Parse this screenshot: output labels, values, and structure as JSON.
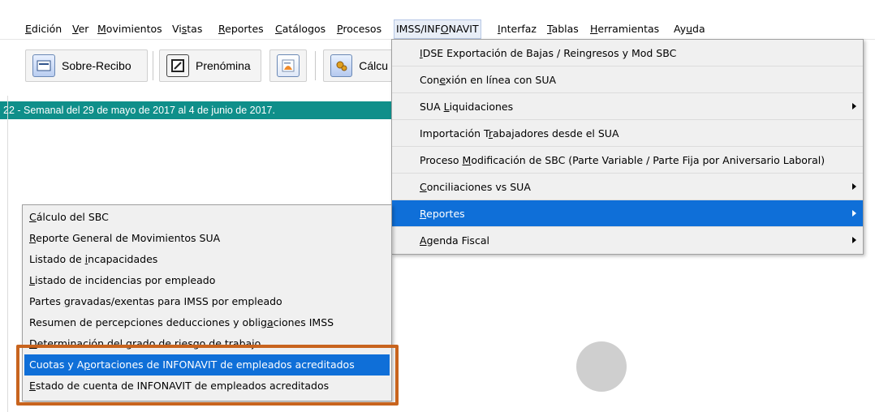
{
  "menubar": [
    {
      "label": "Edición",
      "u": 0
    },
    {
      "label": "Ver",
      "u": 0
    },
    {
      "label": "Movimientos",
      "u": 0
    },
    {
      "label": "Vistas",
      "u": 2
    },
    {
      "label": "Reportes",
      "u": 0
    },
    {
      "label": "Catálogos",
      "u": 0
    },
    {
      "label": "Procesos",
      "u": 0
    },
    {
      "label": "IMSS/INFONAVIT",
      "u": 8
    },
    {
      "label": "Interfaz",
      "u": 0
    },
    {
      "label": "Tablas",
      "u": 0
    },
    {
      "label": "Herramientas",
      "u": 0
    },
    {
      "label": "Ayuda",
      "u": 2
    }
  ],
  "toolbar": {
    "sobre_recibo": "Sobre-Recibo",
    "prenomina": "Prenómina",
    "calculo": "Cálcu"
  },
  "period": "22 - Semanal del 29 de mayo de 2017 al 4 de junio de 2017.",
  "imss_menu": [
    {
      "label": "IDSE Exportación de Bajas / Reingresos y Mod SBC",
      "u": 0,
      "arrow": false
    },
    {
      "label": "Conexión en línea con SUA",
      "u": 3,
      "arrow": false
    },
    {
      "label": "SUA Liquidaciones",
      "u": 4,
      "arrow": true
    },
    {
      "label": "Importación Trabajadores desde el SUA",
      "u": 13,
      "arrow": false
    },
    {
      "label": "Proceso Modificación de SBC (Parte Variable / Parte Fija por Aniversario Laboral)",
      "u": 8,
      "arrow": false
    },
    {
      "label": "Conciliaciones vs SUA",
      "u": 0,
      "arrow": true
    },
    {
      "label": "Reportes",
      "u": 0,
      "arrow": true,
      "selected": true
    },
    {
      "label": "Agenda Fiscal",
      "u": 0,
      "arrow": true
    }
  ],
  "reports_menu": [
    {
      "label": "Cálculo del SBC",
      "u": 0
    },
    {
      "label": "Reporte General de Movimientos SUA",
      "u": 0
    },
    {
      "label": "Listado de incapacidades",
      "u": 11
    },
    {
      "label": "Listado de incidencias por empleado",
      "u": 0
    },
    {
      "label": "Partes gravadas/exentas para IMSS por empleado",
      "u": 7
    },
    {
      "label": "Resumen de percepciones deducciones y obligaciones IMSS",
      "u": 43
    },
    {
      "label": "Determinación del grado de riesgo de trabajo",
      "u": 0
    },
    {
      "label": "Cuotas y Aportaciones de INFONAVIT de empleados acreditados",
      "u": 10,
      "selected": true
    },
    {
      "label": "Estado de cuenta de INFONAVIT de empleados acreditados",
      "u": 0
    }
  ]
}
